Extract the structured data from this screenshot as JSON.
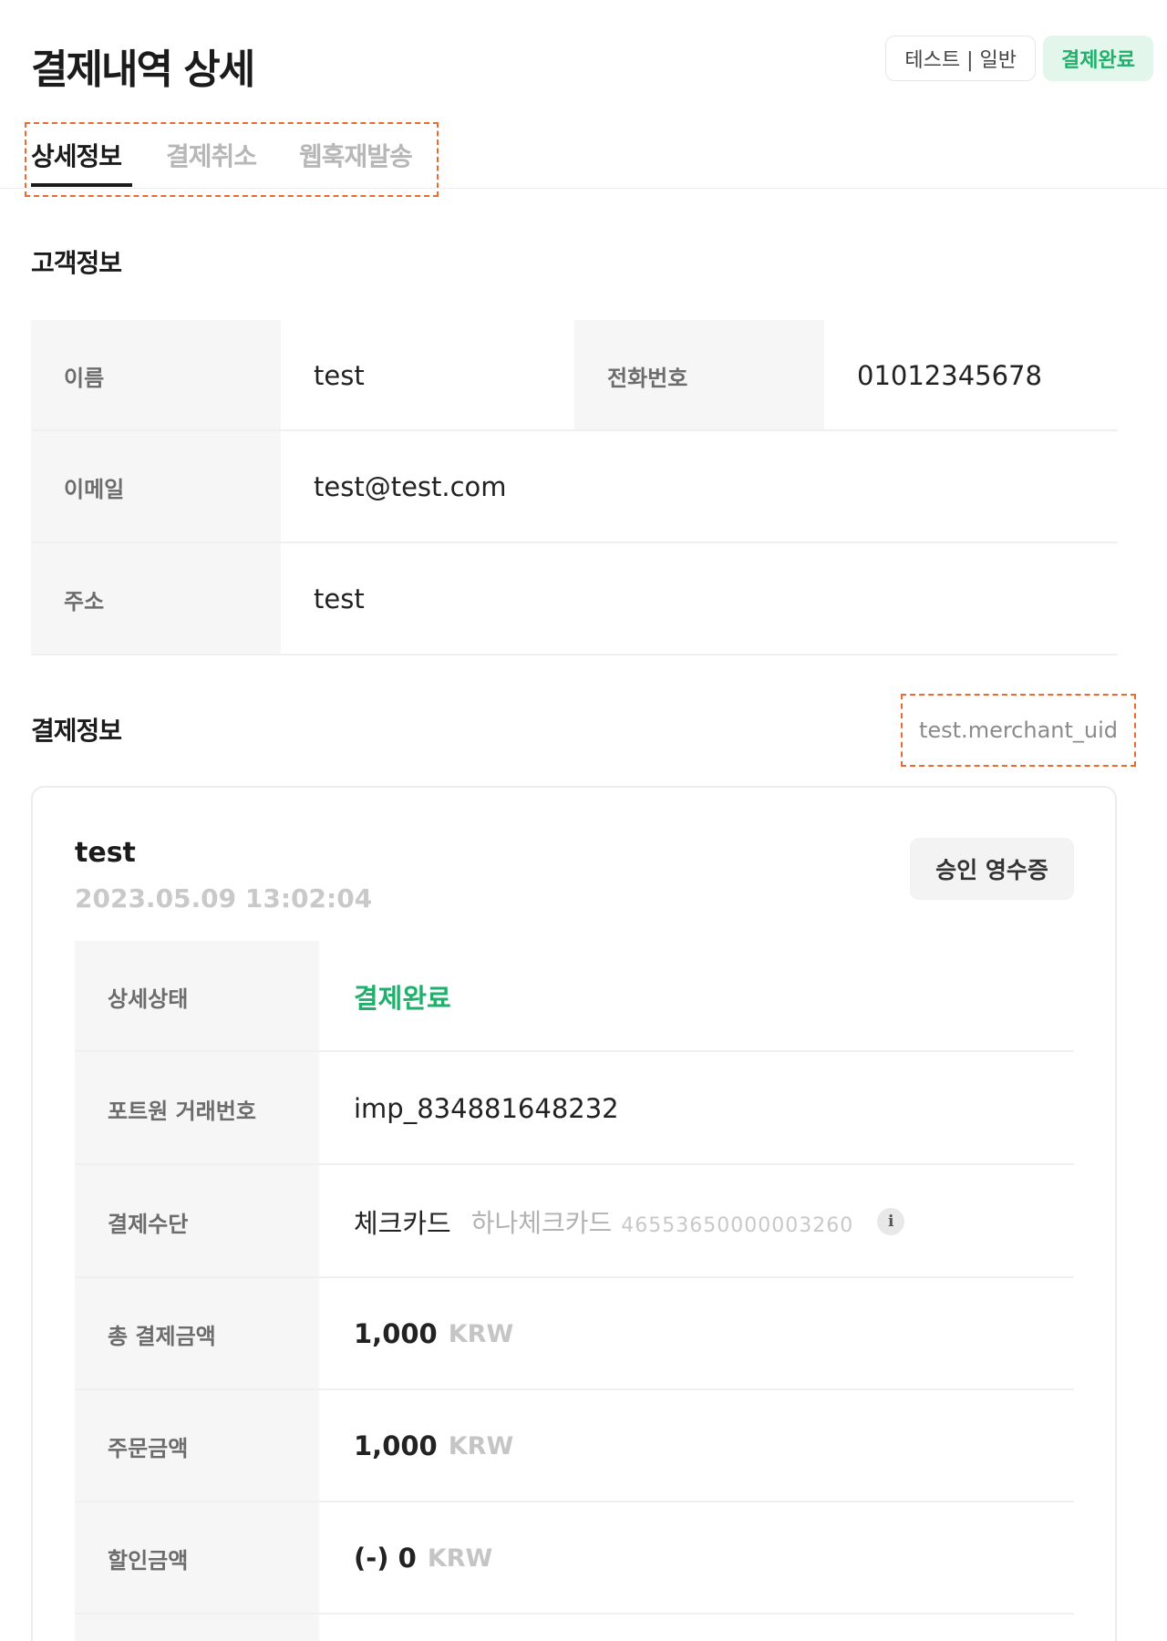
{
  "header": {
    "title": "결제내역 상세",
    "mode_badge": "테스트 | 일반",
    "status_badge": "결제완료"
  },
  "tabs": [
    {
      "label": "상세정보",
      "active": true
    },
    {
      "label": "결제취소",
      "active": false
    },
    {
      "label": "웹훅재발송",
      "active": false
    }
  ],
  "customer": {
    "section_title": "고객정보",
    "name_label": "이름",
    "name": "test",
    "phone_label": "전화번호",
    "phone": "01012345678",
    "email_label": "이메일",
    "email": "test@test.com",
    "address_label": "주소",
    "address": "test"
  },
  "payment": {
    "section_title": "결제정보",
    "merchant_uid": "test.merchant_uid",
    "card": {
      "name": "test",
      "datetime": "2023.05.09 13:02:04",
      "receipt_button": "승인 영수증",
      "rows": {
        "status_label": "상세상태",
        "status_value": "결제완료",
        "txn_label": "포트원 거래번호",
        "txn_value": "imp_834881648232",
        "method_label": "결제수단",
        "method_value": "체크카드",
        "method_card": "하나체크카드",
        "method_number": "46553650000003260",
        "total_label": "총 결제금액",
        "total_amount": "1,000",
        "order_label": "주문금액",
        "order_amount": "1,000",
        "discount_label": "할인금액",
        "discount_amount": "(-) 0",
        "currency": "KRW"
      }
    }
  },
  "colors": {
    "accent_green": "#21b06b",
    "highlight_dashed": "#ec6a2e"
  }
}
